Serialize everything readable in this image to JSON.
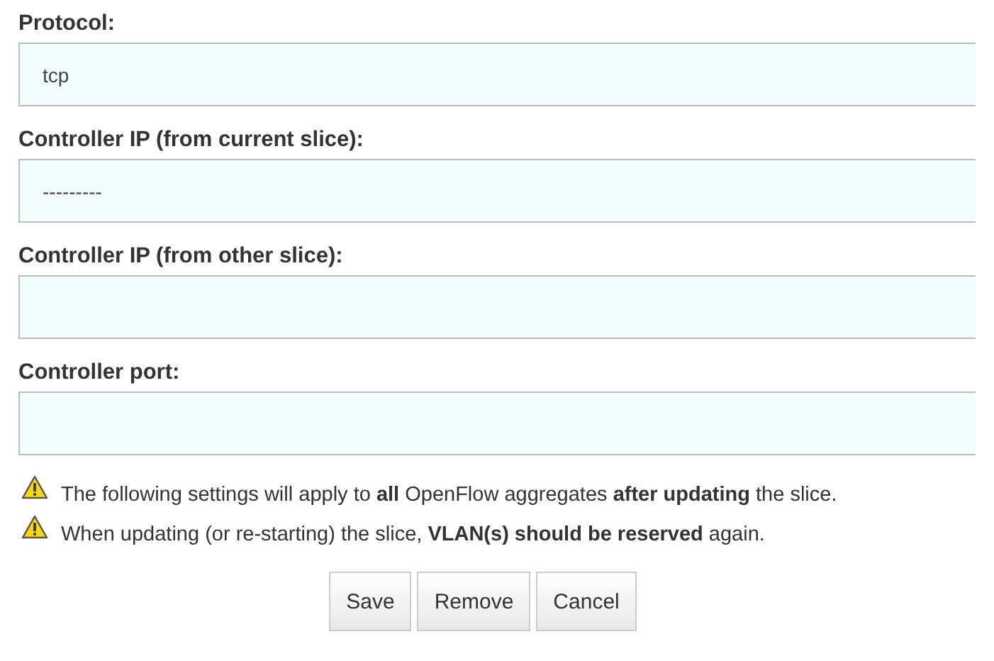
{
  "fields": [
    {
      "label": "Protocol:",
      "kind": "select",
      "value": "tcp"
    },
    {
      "label": "Controller IP (from current slice):",
      "kind": "select",
      "value": "---------"
    },
    {
      "label": "Controller IP (from other slice):",
      "kind": "text"
    },
    {
      "label": "Controller port:",
      "kind": "text"
    }
  ],
  "notices": [
    "The following settings will apply to **all** OpenFlow aggregates **after updating** the slice.",
    "When updating (or re-starting) the slice, **VLAN(s) should be reserved** again."
  ],
  "buttons": [
    "Save",
    "Remove",
    "Cancel"
  ]
}
